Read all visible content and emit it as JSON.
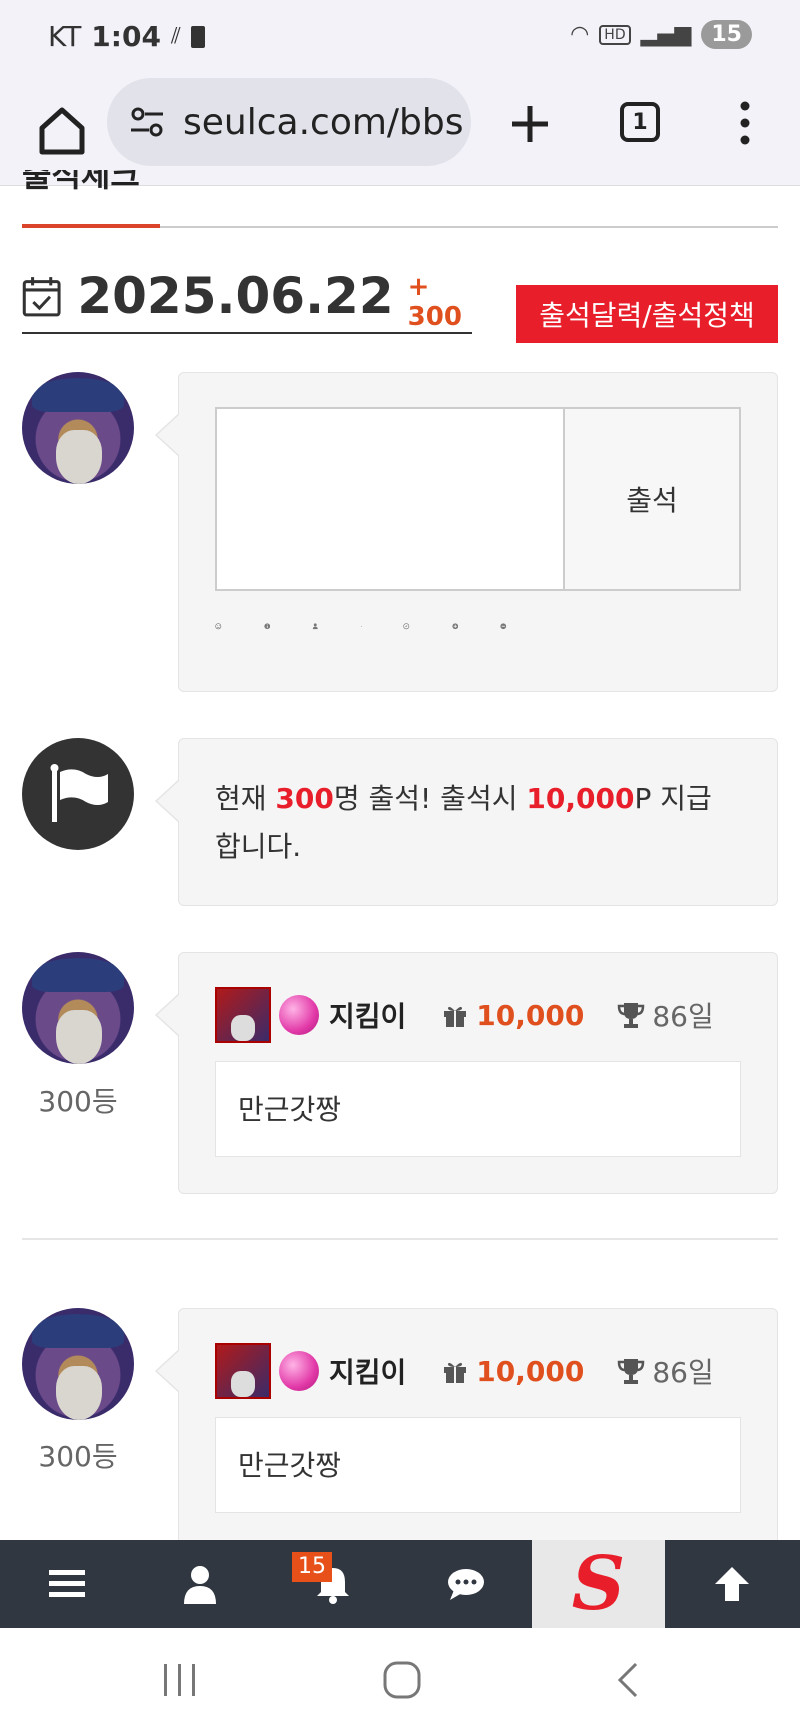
{
  "status_bar": {
    "carrier": "KT",
    "time": "1:04",
    "notification_count": "15"
  },
  "browser": {
    "url": "seulca.com/bbs",
    "tab_count": "1"
  },
  "section": {
    "title": "출석체크"
  },
  "date_row": {
    "date": "2025.06.22",
    "bonus": "+ 300",
    "calendar_button": "출석달력/출석정책"
  },
  "compose": {
    "submit_label": "출석",
    "tools": [
      "smile-icon",
      "info-icon",
      "user-icon",
      "camera-icon",
      "compass-icon",
      "plus-circle-icon",
      "minus-circle-icon"
    ]
  },
  "notice": {
    "prefix": "현재 ",
    "count": "300",
    "middle": "명 출석! 출석시 ",
    "points": "10,000",
    "suffix": "P 지급합니다."
  },
  "entries": [
    {
      "rank": "300등",
      "username": "지킴이",
      "points": "10,000",
      "days": "86일",
      "comment": "만근갓짱"
    },
    {
      "rank": "300등",
      "username": "지킴이",
      "points": "10,000",
      "days": "86일",
      "comment": "만근갓짱"
    }
  ],
  "bottom_nav": {
    "notification_badge": "15",
    "logo_letter": "S"
  },
  "colors": {
    "accent_red": "#e81e2a",
    "points_orange": "#e0501e",
    "nav_dark": "#303740"
  }
}
